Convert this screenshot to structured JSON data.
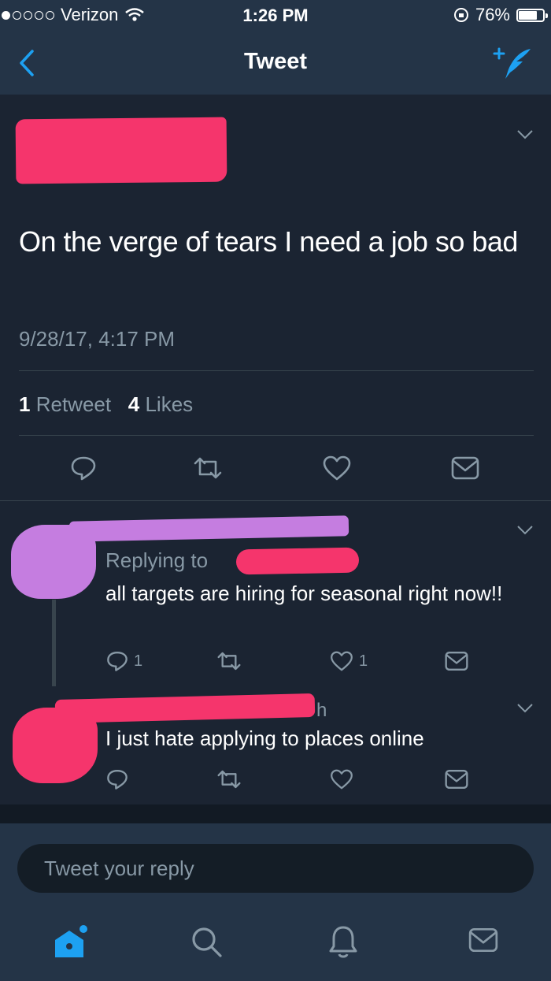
{
  "status_bar": {
    "carrier": "Verizon",
    "time": "1:26 PM",
    "battery": "76%",
    "battery_level": 0.76
  },
  "nav": {
    "title": "Tweet",
    "back_icon": "chevron-left-icon",
    "compose_icon": "compose-tweet-icon"
  },
  "tweet": {
    "text": "On the verge of tears I need a job so bad",
    "timestamp": "9/28/17, 4:17 PM",
    "retweet_count": "1",
    "retweet_label": "Retweet",
    "like_count": "4",
    "like_label": "Likes"
  },
  "replies": [
    {
      "handle_suffix": "",
      "replying_to": "Replying to",
      "text": "all targets are hiring for seasonal right now!!",
      "reply_count": "1",
      "like_count": "1"
    },
    {
      "time_suffix": "h",
      "text": "I just hate applying to places online"
    }
  ],
  "composer": {
    "placeholder": "Tweet your reply"
  },
  "tabs": [
    "home-icon",
    "search-icon",
    "notifications-icon",
    "messages-icon"
  ],
  "colors": {
    "accent": "#1da1f2",
    "background": "#1b2432",
    "bar": "#243447",
    "redaction_pink": "#f5356c",
    "redaction_purple": "#c57de0"
  }
}
